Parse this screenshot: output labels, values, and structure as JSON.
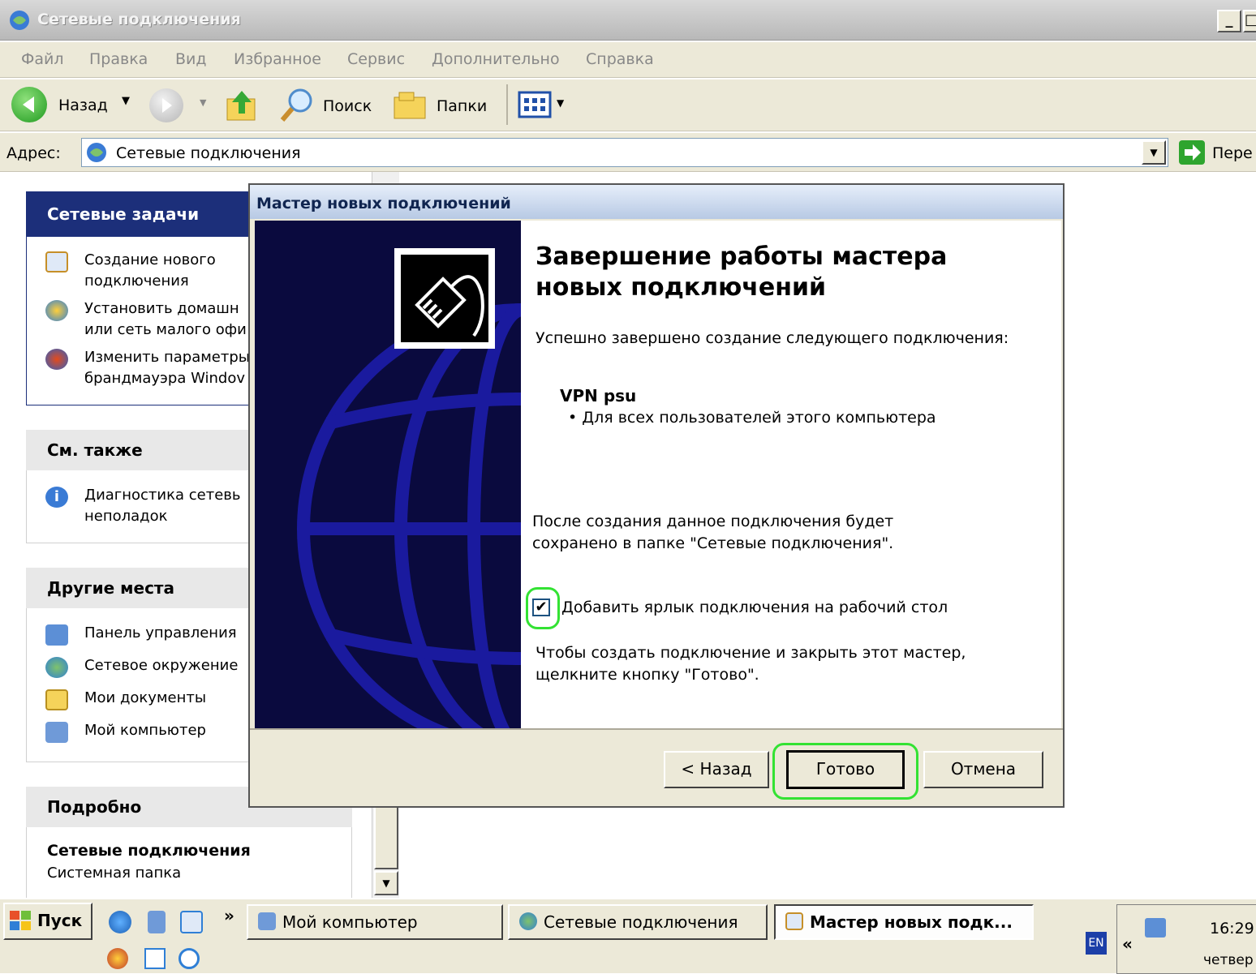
{
  "explorer": {
    "title": "Сетевые подключения",
    "window_buttons": [
      "_",
      "□"
    ],
    "menu": [
      "Файл",
      "Правка",
      "Вид",
      "Избранное",
      "Сервис",
      "Дополнительно",
      "Справка"
    ],
    "toolbar": {
      "back_label": "Назад",
      "search_label": "Поиск",
      "folders_label": "Папки"
    },
    "address": {
      "label": "Адрес:",
      "value": "Сетевые подключения",
      "go_label": "Пере"
    }
  },
  "task_pane": {
    "network_tasks": {
      "title": "Сетевые задачи",
      "items": [
        {
          "line1": "Создание нового",
          "line2": "подключения",
          "icon": "new-connection-icon"
        },
        {
          "line1": "Установить домашн",
          "line2": "или сеть малого офи",
          "icon": "home-network-icon"
        },
        {
          "line1": "Изменить параметры",
          "line2": "брандмауэра Windov",
          "icon": "firewall-icon"
        }
      ]
    },
    "see_also": {
      "title": "См. также",
      "items": [
        {
          "line1": "Диагностика сетевь",
          "line2": "неполадок",
          "icon": "info-icon"
        }
      ]
    },
    "other_places": {
      "title": "Другие места",
      "items": [
        {
          "label": "Панель управления",
          "icon": "control-panel-icon"
        },
        {
          "label": "Сетевое окружение",
          "icon": "network-places-icon"
        },
        {
          "label": "Мои документы",
          "icon": "my-documents-icon"
        },
        {
          "label": "Мой компьютер",
          "icon": "my-computer-icon"
        }
      ]
    },
    "details": {
      "title": "Подробно",
      "name": "Сетевые подключения",
      "type": "Системная папка"
    }
  },
  "wizard": {
    "title": "Мастер новых подключений",
    "heading_line1": "Завершение работы мастера",
    "heading_line2": "новых подключений",
    "success_text": "Успешно завершено создание следующего подключения:",
    "connection_name": "VPN psu",
    "connection_scope": "Для всех пользователей этого компьютера",
    "saved_line1": "После создания данное подключения будет",
    "saved_line2": "сохранено в папке \"Сетевые подключения\".",
    "shortcut_checkbox": {
      "label": "Добавить ярлык подключения на рабочий стол",
      "checked": true
    },
    "finish_hint_line1": "Чтобы создать подключение и закрыть этот мастер,",
    "finish_hint_line2": "щелкните кнопку \"Готово\".",
    "buttons": {
      "back": "< Назад",
      "finish": "Готово",
      "cancel": "Отмена"
    }
  },
  "taskbar": {
    "start_label": "Пуск",
    "overflow": "»",
    "tasks": [
      {
        "label": "Мой компьютер",
        "active": false
      },
      {
        "label": "Сетевые подключения",
        "active": false
      },
      {
        "label": "Мастер новых подк...",
        "active": true
      }
    ],
    "language": "EN",
    "tray_expand": "«",
    "clock_time": "16:29",
    "clock_day": "четвер"
  },
  "colors": {
    "highlight": "#33e233",
    "banner": "#0a0a3e",
    "globe": "#1a1a9e"
  }
}
